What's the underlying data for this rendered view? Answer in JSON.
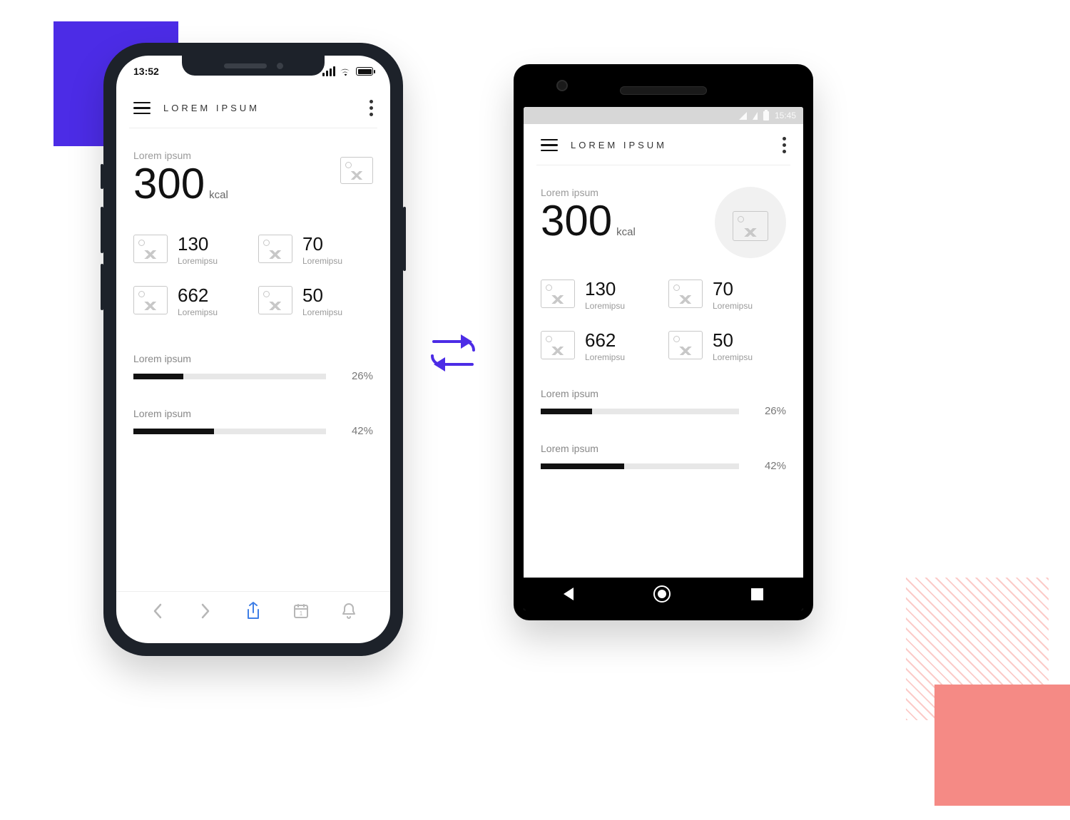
{
  "decorations": {
    "purple": "#4C2CE6",
    "pink": "#F58A85"
  },
  "ios_status": {
    "time": "13:52"
  },
  "android_status": {
    "time": "15:45"
  },
  "app": {
    "title": "LOREM IPSUM",
    "hero": {
      "label": "Lorem ipsum",
      "value": "300",
      "unit": "kcal"
    },
    "stats": [
      {
        "value": "130",
        "sub": "Loremipsu"
      },
      {
        "value": "70",
        "sub": "Loremipsu"
      },
      {
        "value": "662",
        "sub": "Loremipsu"
      },
      {
        "value": "50",
        "sub": "Loremipsu"
      }
    ],
    "progress": [
      {
        "label": "Lorem ipsum",
        "percent": 26,
        "display": "26%"
      },
      {
        "label": "Lorem ipsum",
        "percent": 42,
        "display": "42%"
      }
    ]
  }
}
